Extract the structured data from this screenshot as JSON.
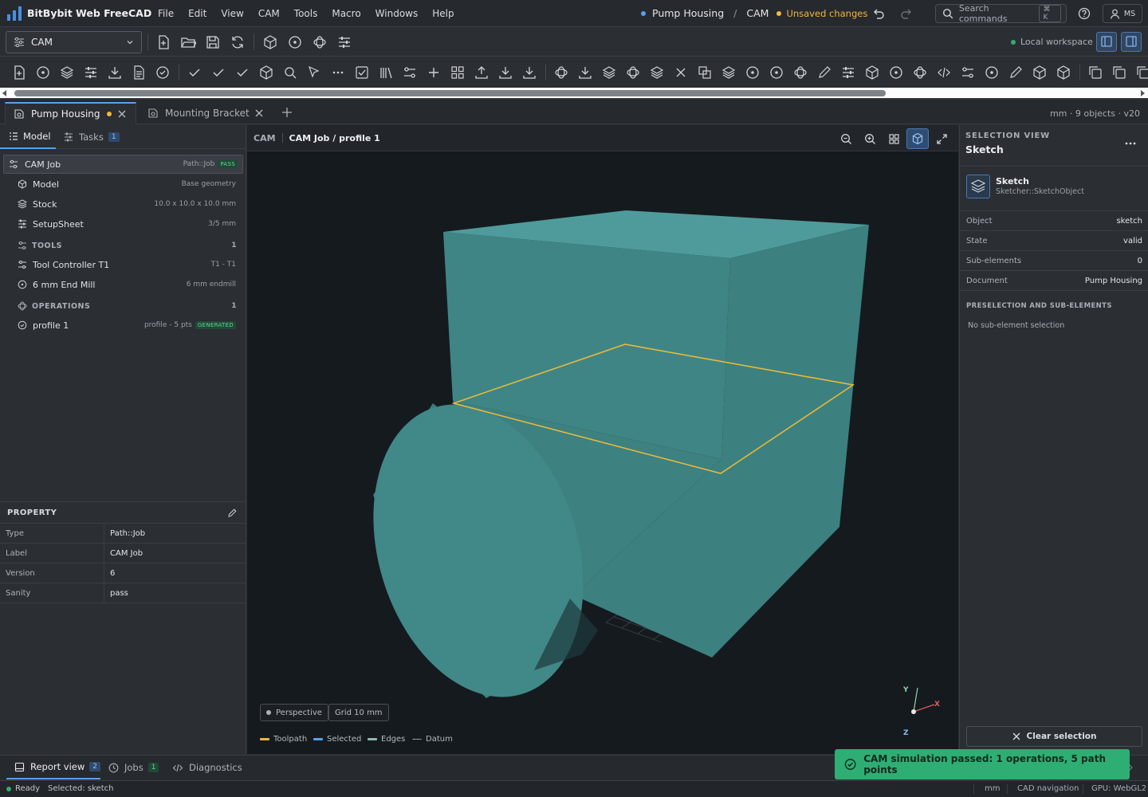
{
  "app": {
    "name": "BitBybit Web FreeCAD"
  },
  "menu": [
    "File",
    "Edit",
    "View",
    "CAM",
    "Tools",
    "Macro",
    "Windows",
    "Help"
  ],
  "doc_crumb": {
    "document": "Pump Housing",
    "separator": "/",
    "workbench": "CAM",
    "status": "Unsaved changes"
  },
  "search": {
    "placeholder": "Search commands",
    "shortcut": "⌘ K"
  },
  "user": {
    "initials": "MS"
  },
  "toolbar": {
    "workbench": "CAM",
    "workspace_status": "Local workspace"
  },
  "doc_tabs": [
    {
      "label": "Pump Housing",
      "modified": true,
      "active": true
    },
    {
      "label": "Mounting Bracket",
      "modified": false,
      "active": false
    }
  ],
  "doc_meta": "mm · 9 objects · v20",
  "left_tabs": {
    "model": "Model",
    "tasks": "Tasks",
    "tasks_count": "1"
  },
  "tree": {
    "job": {
      "label": "CAM Job",
      "type": "Path::Job",
      "badge": "PASS"
    },
    "model": {
      "label": "Model",
      "meta": "Base geometry"
    },
    "stock": {
      "label": "Stock",
      "meta": "10.0 x 10.0 x 10.0 mm"
    },
    "setup": {
      "label": "SetupSheet",
      "meta": "3/5 mm"
    },
    "tools_section": {
      "label": "TOOLS",
      "count": "1"
    },
    "tool_controller": {
      "label": "Tool Controller T1",
      "meta": "T1 - T1"
    },
    "end_mill": {
      "label": "6 mm End Mill",
      "meta": "6 mm endmill"
    },
    "ops_section": {
      "label": "OPERATIONS",
      "count": "1"
    },
    "profile": {
      "label": "profile 1",
      "meta": "profile - 5 pts",
      "badge": "GENERATED"
    }
  },
  "property": {
    "header": "PROPERTY",
    "rows": [
      {
        "key": "Type",
        "value": "Path::Job"
      },
      {
        "key": "Label",
        "value": "CAM Job"
      },
      {
        "key": "Version",
        "value": "6"
      },
      {
        "key": "Sanity",
        "value": "pass"
      }
    ]
  },
  "viewport": {
    "workbench": "CAM",
    "path": "CAM Job / profile 1",
    "projection": "Perspective",
    "grid": "Grid 10 mm",
    "legend": [
      {
        "label": "Toolpath",
        "color": "#e8b93a"
      },
      {
        "label": "Selected",
        "color": "#5aa0e8"
      },
      {
        "label": "Edges",
        "color": "#8fb9b2"
      },
      {
        "label": "Datum",
        "color": "#a9aeb5"
      }
    ],
    "axes": {
      "x": "X",
      "y": "Y",
      "z": "Z"
    }
  },
  "selection": {
    "header": "SELECTION VIEW",
    "title": "Sketch",
    "object_name": "Sketch",
    "object_type": "Sketcher::SketchObject",
    "rows": [
      {
        "key": "Object",
        "value": "sketch"
      },
      {
        "key": "State",
        "value": "valid"
      },
      {
        "key": "Sub-elements",
        "value": "0"
      },
      {
        "key": "Document",
        "value": "Pump Housing"
      }
    ],
    "subsection": "PRESELECTION AND SUB-ELEMENTS",
    "empty": "No sub-element selection",
    "clear_button": "Clear selection"
  },
  "bottom_tabs": [
    {
      "label": "Report view",
      "count": "2"
    },
    {
      "label": "Jobs",
      "count": "1"
    },
    {
      "label": "Diagnostics"
    }
  ],
  "toast": "CAM simulation passed: 1 operations, 5 path points",
  "status": {
    "state": "Ready",
    "selected": "Selected: sketch",
    "units": "mm",
    "navigation": "CAD navigation",
    "gpu": "GPU: WebGL2"
  },
  "colors": {
    "accent": "#5aa0e8",
    "success": "#2fae73",
    "warning": "#f2b740",
    "model": "#3e8484"
  }
}
